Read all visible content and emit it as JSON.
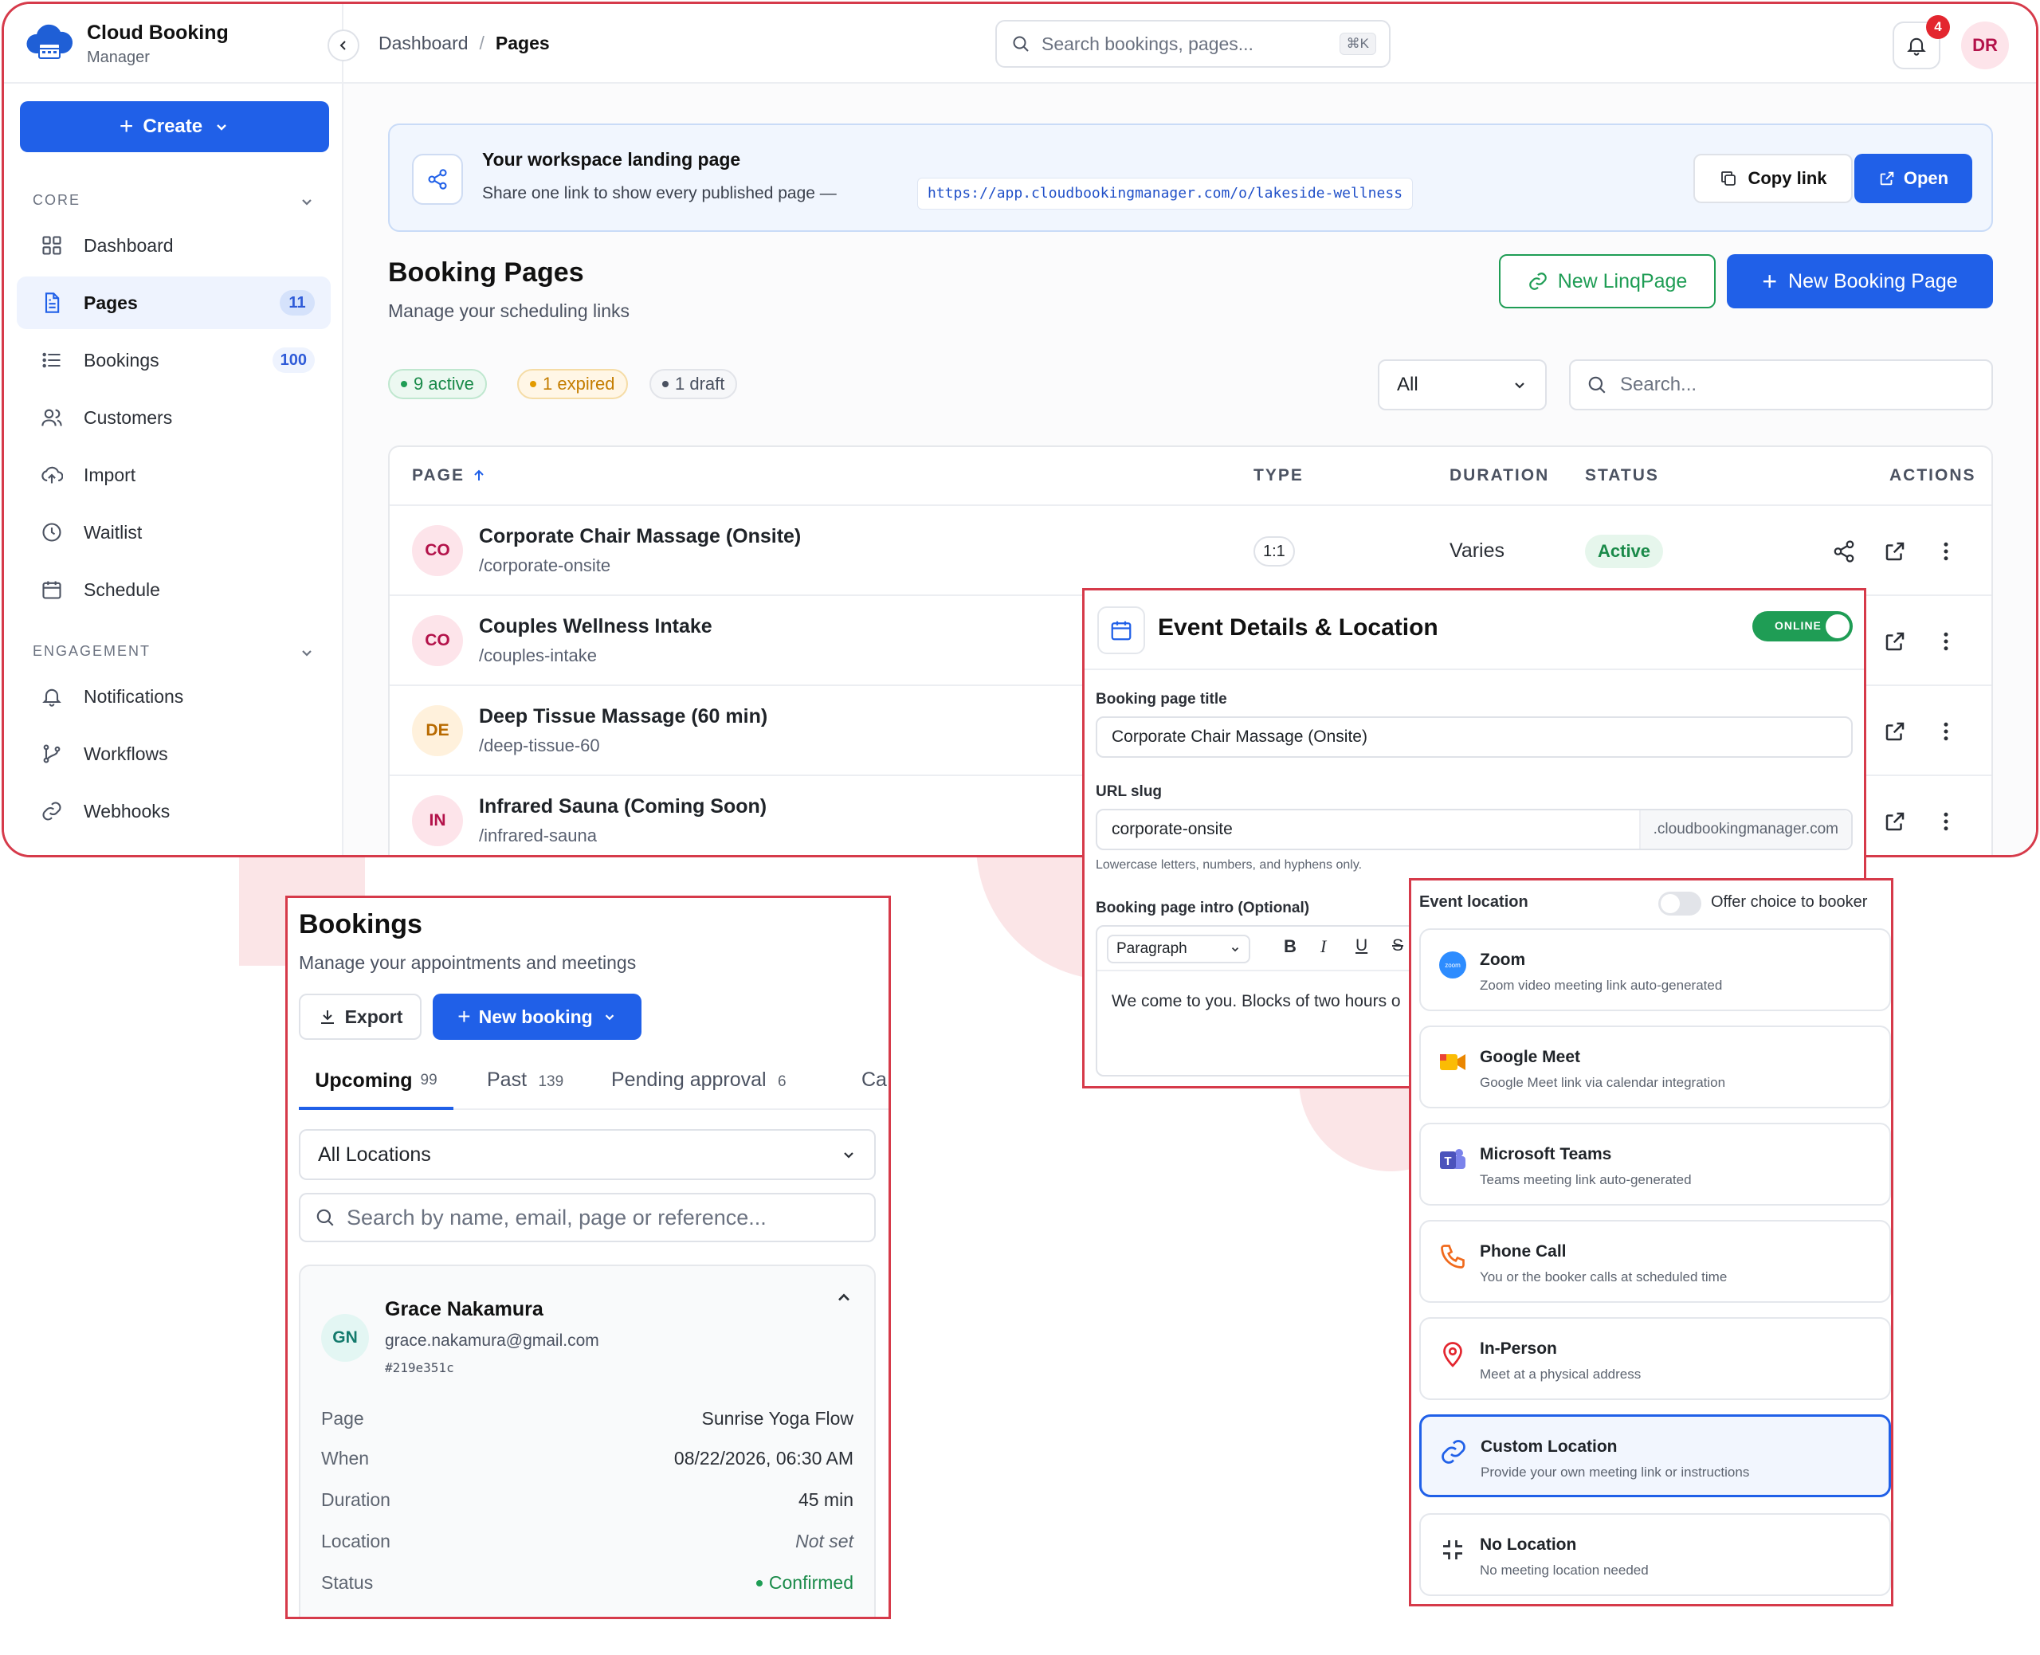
{
  "brand": {
    "name": "Cloud Booking",
    "sub": "Manager"
  },
  "sidebar": {
    "create_label": "Create",
    "core_label": "CORE",
    "engagement_label": "ENGAGEMENT",
    "items": [
      {
        "label": "Dashboard",
        "count": ""
      },
      {
        "label": "Pages",
        "count": "11"
      },
      {
        "label": "Bookings",
        "count": "100"
      },
      {
        "label": "Customers",
        "count": ""
      },
      {
        "label": "Import",
        "count": ""
      },
      {
        "label": "Waitlist",
        "count": ""
      },
      {
        "label": "Schedule",
        "count": ""
      }
    ],
    "engagement_items": [
      {
        "label": "Notifications"
      },
      {
        "label": "Workflows"
      },
      {
        "label": "Webhooks"
      }
    ]
  },
  "topbar": {
    "breadcrumb": [
      "Dashboard",
      "Pages"
    ],
    "breadcrumb_sep": "/",
    "search_placeholder": "Search bookings, pages...",
    "search_shortcut": "⌘K",
    "notif_count": "4",
    "user_initials": "DR"
  },
  "landing": {
    "title": "Your workspace landing page",
    "desc": "Share one link to show every published page —",
    "url": "https://app.cloudbookingmanager.com/o/lakeside-wellness",
    "copy_label": "Copy link",
    "open_label": "Open"
  },
  "pages": {
    "title": "Booking Pages",
    "subtitle": "Manage your scheduling links",
    "new_linq_label": "New LinqPage",
    "new_page_label": "New Booking Page",
    "badges": {
      "active": "9 active",
      "expired": "1 expired",
      "draft": "1 draft"
    },
    "filter_value": "All",
    "search_placeholder": "Search...",
    "columns": [
      "PAGE",
      "TYPE",
      "DURATION",
      "STATUS",
      "ACTIONS"
    ],
    "rows": [
      {
        "initials": "CO",
        "title": "Corporate Chair Massage (Onsite)",
        "slug": "/corporate-onsite",
        "type": "1:1",
        "duration": "Varies",
        "status": "Active"
      },
      {
        "initials": "CO",
        "title": "Couples Wellness Intake",
        "slug": "/couples-intake"
      },
      {
        "initials": "DE",
        "title": "Deep Tissue Massage (60 min)",
        "slug": "/deep-tissue-60"
      },
      {
        "initials": "IN",
        "title": "Infrared Sauna (Coming Soon)",
        "slug": "/infrared-sauna"
      }
    ]
  },
  "event_panel": {
    "title": "Event Details & Location",
    "toggle_label": "ONLINE",
    "title_label": "Booking page title",
    "title_value": "Corporate Chair Massage (Onsite)",
    "slug_label": "URL slug",
    "slug_value": "corporate-onsite",
    "slug_suffix": ".cloudbookingmanager.com",
    "slug_hint": "Lowercase letters, numbers, and hyphens only.",
    "intro_label": "Booking page intro (Optional)",
    "format_value": "Paragraph",
    "intro_text": "We come to you. Blocks of two hours o"
  },
  "location_panel": {
    "title": "Event location",
    "offer_label": "Offer choice to booker",
    "options": [
      {
        "name": "Zoom",
        "desc": "Zoom video meeting link auto-generated",
        "icon": "zoom-icon"
      },
      {
        "name": "Google Meet",
        "desc": "Google Meet link via calendar integration",
        "icon": "google-meet-icon"
      },
      {
        "name": "Microsoft Teams",
        "desc": "Teams meeting link auto-generated",
        "icon": "teams-icon"
      },
      {
        "name": "Phone Call",
        "desc": "You or the booker calls at scheduled time",
        "icon": "phone-icon"
      },
      {
        "name": "In-Person",
        "desc": "Meet at a physical address",
        "icon": "map-pin-icon"
      },
      {
        "name": "Custom Location",
        "desc": "Provide your own meeting link or instructions",
        "icon": "link-icon",
        "selected": true
      },
      {
        "name": "No Location",
        "desc": "No meeting location needed",
        "icon": "minimize-icon"
      }
    ]
  },
  "bookings_panel": {
    "title": "Bookings",
    "subtitle": "Manage your appointments and meetings",
    "export_label": "Export",
    "new_label": "New booking",
    "tabs": [
      {
        "label": "Upcoming",
        "count": "99"
      },
      {
        "label": "Past",
        "count": "139"
      },
      {
        "label": "Pending approval",
        "count": "6"
      },
      {
        "label": "Ca",
        "count": ""
      }
    ],
    "location_filter": "All Locations",
    "search_placeholder": "Search by name, email, page or reference...",
    "booking": {
      "initials": "GN",
      "name": "Grace Nakamura",
      "email": "grace.nakamura@gmail.com",
      "ref": "#219e351c",
      "fields": [
        {
          "k": "Page",
          "v": "Sunrise Yoga Flow"
        },
        {
          "k": "When",
          "v": "08/22/2026, 06:30 AM"
        },
        {
          "k": "Duration",
          "v": "45 min"
        },
        {
          "k": "Location",
          "v": "Not set"
        },
        {
          "k": "Status",
          "v": "Confirmed"
        }
      ]
    }
  },
  "colors": {
    "accent": "#2060e8",
    "frame": "#d63a4a",
    "success": "#1f9d55",
    "warning": "#d68a00"
  }
}
